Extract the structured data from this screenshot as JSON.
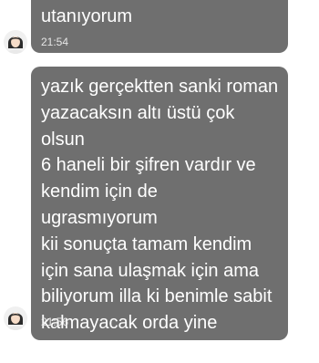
{
  "messages": [
    {
      "text": "utanıyorum",
      "time": "21:54",
      "avatar_icon": "woman-avatar-icon"
    },
    {
      "text": "yazık gerçektten sanki roman\nyazacaksın altı üstü çok olsun\n6 haneli bir şifren vardır ve\nkendim için de ugrasmıyorum\nkii sonuçta tamam kendim\niçin sana ulaşmak için ama\nbiliyorum illa ki benimle sabit\nkalmayacak orda yine\nbayanlarla yazısacaksın",
      "time": "21:56",
      "avatar_icon": "woman-avatar-icon"
    }
  ],
  "colors": {
    "bubble_background": "#6f6f6f",
    "bubble_text": "#ffffff",
    "page_background": "#ffffff"
  }
}
